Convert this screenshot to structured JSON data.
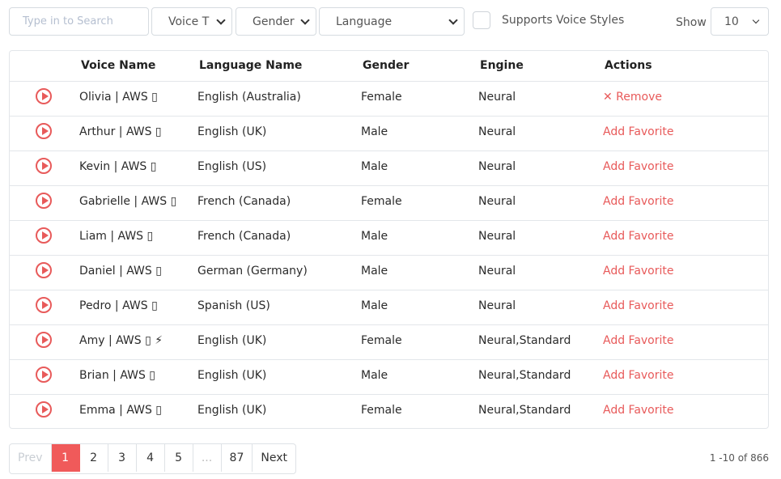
{
  "filters": {
    "search_placeholder": "Type in to Search",
    "voice_type": "Voice T",
    "gender": "Gender",
    "language": "Language",
    "supports_label": "Supports Voice Styles",
    "show_label": "Show",
    "show_value": "10"
  },
  "table": {
    "headers": [
      "Voice Name",
      "Language Name",
      "Gender",
      "Engine",
      "Actions"
    ],
    "rows": [
      {
        "name": "Olivia | AWS ▯",
        "language": "English (Australia)",
        "gender": "Female",
        "engine": "Neural",
        "action": "✕ Remove"
      },
      {
        "name": "Arthur | AWS ▯",
        "language": "English (UK)",
        "gender": "Male",
        "engine": "Neural",
        "action": "Add Favorite"
      },
      {
        "name": "Kevin | AWS ▯",
        "language": "English (US)",
        "gender": "Male",
        "engine": "Neural",
        "action": "Add Favorite"
      },
      {
        "name": "Gabrielle | AWS ▯",
        "language": "French (Canada)",
        "gender": "Female",
        "engine": "Neural",
        "action": "Add Favorite"
      },
      {
        "name": "Liam | AWS ▯",
        "language": "French (Canada)",
        "gender": "Male",
        "engine": "Neural",
        "action": "Add Favorite"
      },
      {
        "name": "Daniel | AWS ▯",
        "language": "German (Germany)",
        "gender": "Male",
        "engine": "Neural",
        "action": "Add Favorite"
      },
      {
        "name": "Pedro | AWS ▯",
        "language": "Spanish (US)",
        "gender": "Male",
        "engine": "Neural",
        "action": "Add Favorite"
      },
      {
        "name": "Amy | AWS ▯ ⚡",
        "language": "English (UK)",
        "gender": "Female",
        "engine": "Neural,Standard",
        "action": "Add Favorite"
      },
      {
        "name": "Brian | AWS ▯",
        "language": "English (UK)",
        "gender": "Male",
        "engine": "Neural,Standard",
        "action": "Add Favorite"
      },
      {
        "name": "Emma | AWS ▯",
        "language": "English (UK)",
        "gender": "Female",
        "engine": "Neural,Standard",
        "action": "Add Favorite"
      }
    ]
  },
  "pagination": {
    "prev": "Prev",
    "pages": [
      "1",
      "2",
      "3",
      "4",
      "5",
      "...",
      "87"
    ],
    "active_page": "1",
    "next": "Next",
    "range_text": "1 -10 of 866"
  },
  "colors": {
    "accent": "#f05a5a",
    "link": "#e85a5a"
  }
}
